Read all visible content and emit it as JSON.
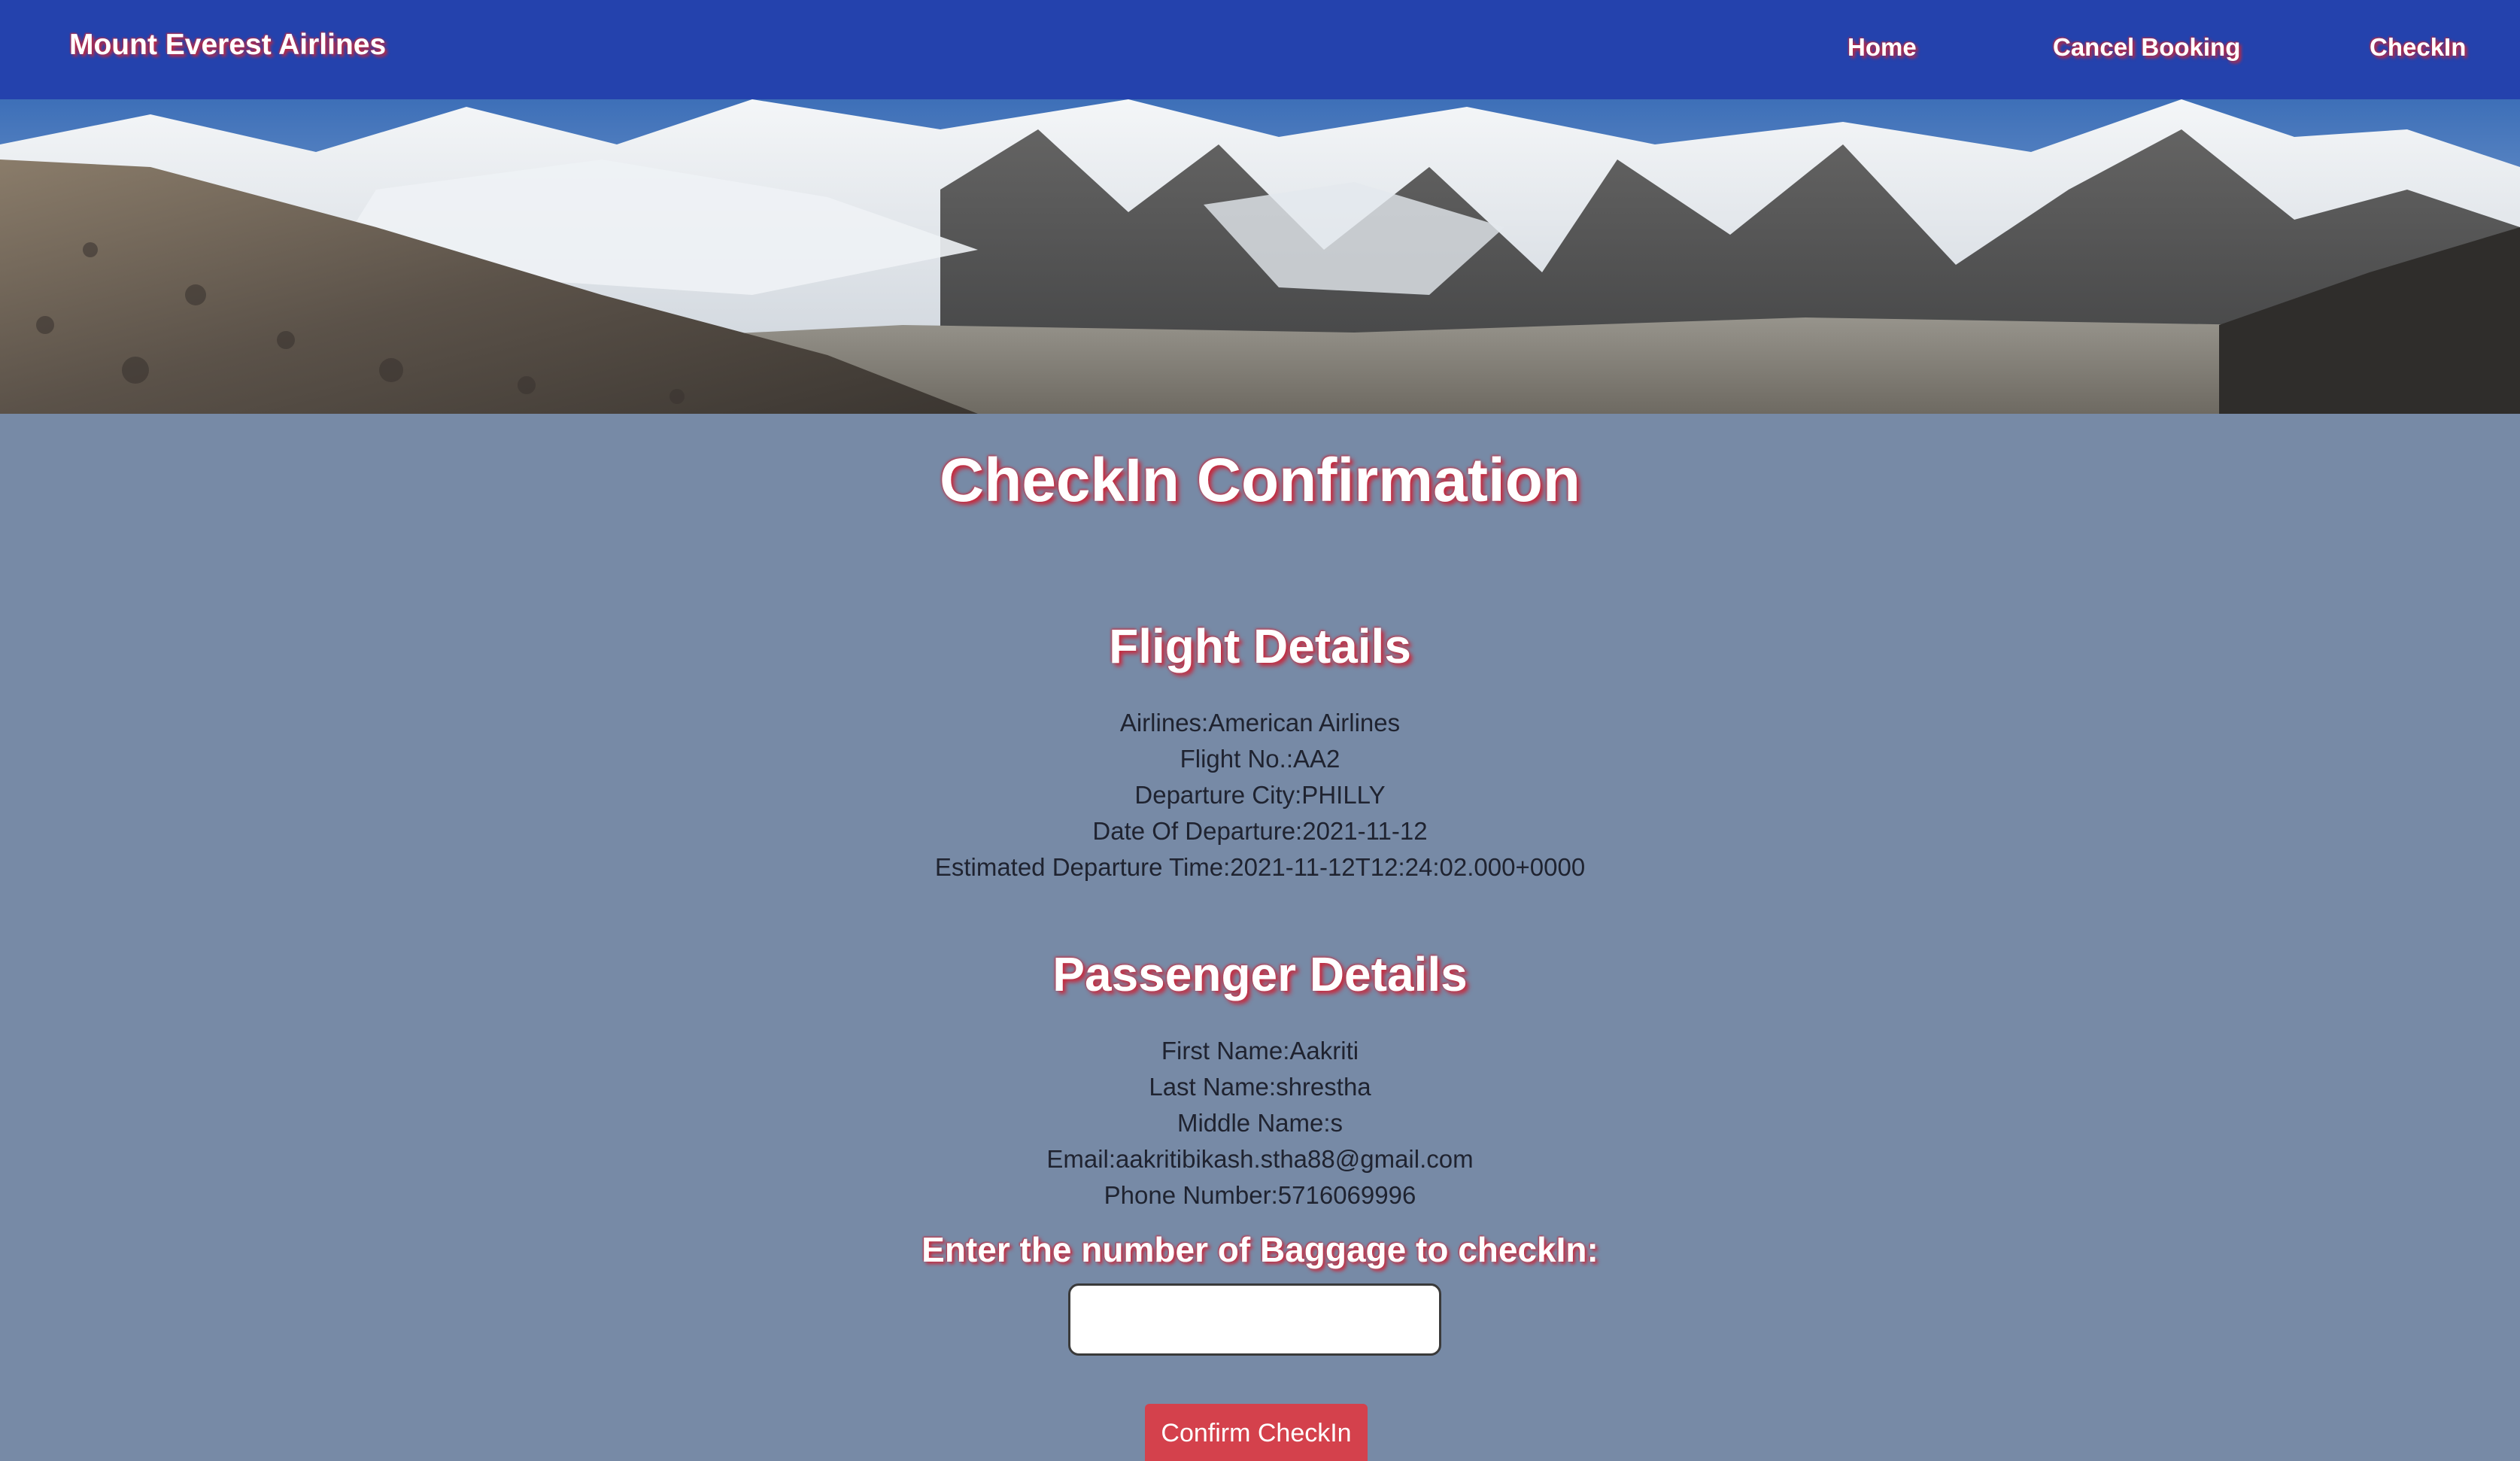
{
  "navbar": {
    "brand": "Mount Everest Airlines",
    "links": [
      {
        "label": "Home"
      },
      {
        "label": "Cancel Booking"
      },
      {
        "label": "CheckIn"
      }
    ],
    "background_color": "#2442ad"
  },
  "page": {
    "title": "CheckIn Confirmation",
    "background_color": "#778aa6"
  },
  "flight": {
    "heading": "Flight Details",
    "lines": [
      "Airlines:American Airlines",
      "Flight No.:AA2",
      "Departure City:PHILLY",
      "Date Of Departure:2021-11-12",
      "Estimated Departure Time:2021-11-12T12:24:02.000+0000"
    ]
  },
  "passenger": {
    "heading": "Passenger Details",
    "lines": [
      "First Name:Aakriti",
      "Last Name:shrestha",
      "Middle Name:s",
      "Email:aakritibikash.stha88@gmail.com",
      "Phone Number:5716069996"
    ]
  },
  "baggage": {
    "label": "Enter the number of Baggage to checkIn:",
    "value": ""
  },
  "confirm_button": {
    "label": "Confirm CheckIn",
    "color": "#d4414c"
  },
  "text_shadow_color": "#c8283c"
}
